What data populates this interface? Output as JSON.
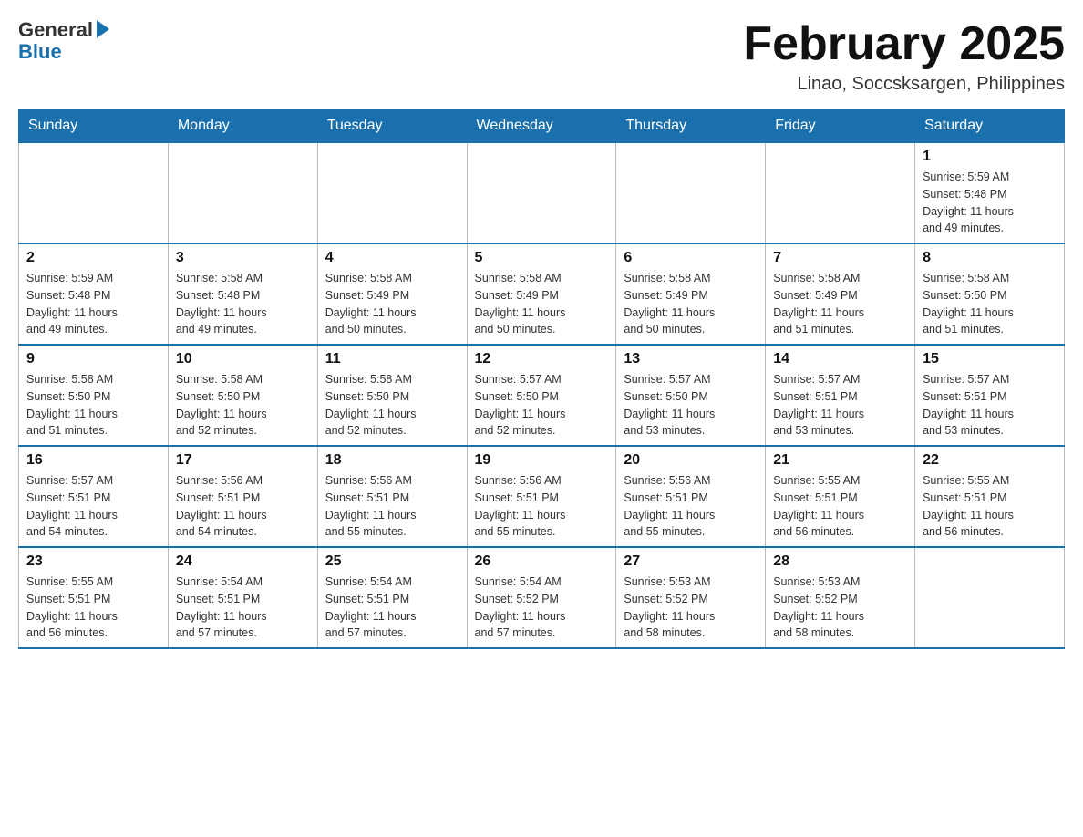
{
  "header": {
    "logo_general": "General",
    "logo_blue": "Blue",
    "title": "February 2025",
    "location": "Linao, Soccsksargen, Philippines"
  },
  "calendar": {
    "days_of_week": [
      "Sunday",
      "Monday",
      "Tuesday",
      "Wednesday",
      "Thursday",
      "Friday",
      "Saturday"
    ],
    "weeks": [
      [
        {
          "day": "",
          "info": ""
        },
        {
          "day": "",
          "info": ""
        },
        {
          "day": "",
          "info": ""
        },
        {
          "day": "",
          "info": ""
        },
        {
          "day": "",
          "info": ""
        },
        {
          "day": "",
          "info": ""
        },
        {
          "day": "1",
          "info": "Sunrise: 5:59 AM\nSunset: 5:48 PM\nDaylight: 11 hours\nand 49 minutes."
        }
      ],
      [
        {
          "day": "2",
          "info": "Sunrise: 5:59 AM\nSunset: 5:48 PM\nDaylight: 11 hours\nand 49 minutes."
        },
        {
          "day": "3",
          "info": "Sunrise: 5:58 AM\nSunset: 5:48 PM\nDaylight: 11 hours\nand 49 minutes."
        },
        {
          "day": "4",
          "info": "Sunrise: 5:58 AM\nSunset: 5:49 PM\nDaylight: 11 hours\nand 50 minutes."
        },
        {
          "day": "5",
          "info": "Sunrise: 5:58 AM\nSunset: 5:49 PM\nDaylight: 11 hours\nand 50 minutes."
        },
        {
          "day": "6",
          "info": "Sunrise: 5:58 AM\nSunset: 5:49 PM\nDaylight: 11 hours\nand 50 minutes."
        },
        {
          "day": "7",
          "info": "Sunrise: 5:58 AM\nSunset: 5:49 PM\nDaylight: 11 hours\nand 51 minutes."
        },
        {
          "day": "8",
          "info": "Sunrise: 5:58 AM\nSunset: 5:50 PM\nDaylight: 11 hours\nand 51 minutes."
        }
      ],
      [
        {
          "day": "9",
          "info": "Sunrise: 5:58 AM\nSunset: 5:50 PM\nDaylight: 11 hours\nand 51 minutes."
        },
        {
          "day": "10",
          "info": "Sunrise: 5:58 AM\nSunset: 5:50 PM\nDaylight: 11 hours\nand 52 minutes."
        },
        {
          "day": "11",
          "info": "Sunrise: 5:58 AM\nSunset: 5:50 PM\nDaylight: 11 hours\nand 52 minutes."
        },
        {
          "day": "12",
          "info": "Sunrise: 5:57 AM\nSunset: 5:50 PM\nDaylight: 11 hours\nand 52 minutes."
        },
        {
          "day": "13",
          "info": "Sunrise: 5:57 AM\nSunset: 5:50 PM\nDaylight: 11 hours\nand 53 minutes."
        },
        {
          "day": "14",
          "info": "Sunrise: 5:57 AM\nSunset: 5:51 PM\nDaylight: 11 hours\nand 53 minutes."
        },
        {
          "day": "15",
          "info": "Sunrise: 5:57 AM\nSunset: 5:51 PM\nDaylight: 11 hours\nand 53 minutes."
        }
      ],
      [
        {
          "day": "16",
          "info": "Sunrise: 5:57 AM\nSunset: 5:51 PM\nDaylight: 11 hours\nand 54 minutes."
        },
        {
          "day": "17",
          "info": "Sunrise: 5:56 AM\nSunset: 5:51 PM\nDaylight: 11 hours\nand 54 minutes."
        },
        {
          "day": "18",
          "info": "Sunrise: 5:56 AM\nSunset: 5:51 PM\nDaylight: 11 hours\nand 55 minutes."
        },
        {
          "day": "19",
          "info": "Sunrise: 5:56 AM\nSunset: 5:51 PM\nDaylight: 11 hours\nand 55 minutes."
        },
        {
          "day": "20",
          "info": "Sunrise: 5:56 AM\nSunset: 5:51 PM\nDaylight: 11 hours\nand 55 minutes."
        },
        {
          "day": "21",
          "info": "Sunrise: 5:55 AM\nSunset: 5:51 PM\nDaylight: 11 hours\nand 56 minutes."
        },
        {
          "day": "22",
          "info": "Sunrise: 5:55 AM\nSunset: 5:51 PM\nDaylight: 11 hours\nand 56 minutes."
        }
      ],
      [
        {
          "day": "23",
          "info": "Sunrise: 5:55 AM\nSunset: 5:51 PM\nDaylight: 11 hours\nand 56 minutes."
        },
        {
          "day": "24",
          "info": "Sunrise: 5:54 AM\nSunset: 5:51 PM\nDaylight: 11 hours\nand 57 minutes."
        },
        {
          "day": "25",
          "info": "Sunrise: 5:54 AM\nSunset: 5:51 PM\nDaylight: 11 hours\nand 57 minutes."
        },
        {
          "day": "26",
          "info": "Sunrise: 5:54 AM\nSunset: 5:52 PM\nDaylight: 11 hours\nand 57 minutes."
        },
        {
          "day": "27",
          "info": "Sunrise: 5:53 AM\nSunset: 5:52 PM\nDaylight: 11 hours\nand 58 minutes."
        },
        {
          "day": "28",
          "info": "Sunrise: 5:53 AM\nSunset: 5:52 PM\nDaylight: 11 hours\nand 58 minutes."
        },
        {
          "day": "",
          "info": ""
        }
      ]
    ]
  }
}
